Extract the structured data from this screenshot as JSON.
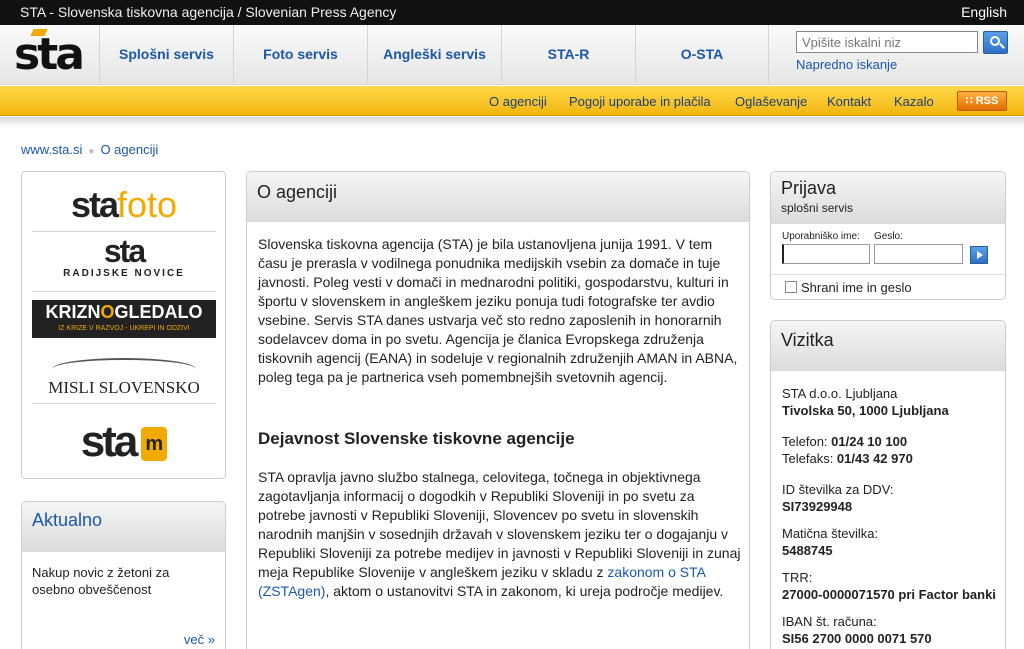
{
  "topbar": {
    "title": "STA - Slovenska tiskovna agencija / Slovenian Press Agency",
    "language": "English"
  },
  "logo": {
    "text": "sta"
  },
  "nav": [
    {
      "label": "Splošni servis"
    },
    {
      "label": "Foto servis"
    },
    {
      "label": "Angleški servis"
    },
    {
      "label": "STA-R"
    },
    {
      "label": "O-STA"
    }
  ],
  "search": {
    "placeholder": "Vpišite iskalni niz",
    "advanced": "Napredno iskanje"
  },
  "subnav": [
    {
      "label": "O agenciji"
    },
    {
      "label": "Pogoji uporabe in plačila"
    },
    {
      "label": "Oglaševanje"
    },
    {
      "label": "Kontakt"
    },
    {
      "label": "Kazalo"
    }
  ],
  "rss": "RSS",
  "breadcrumb": {
    "home": "www.sta.si",
    "current": "O agenciji"
  },
  "brand_logos": {
    "stafoto_a": "sta",
    "stafoto_b": "foto",
    "radijske_a": "sta",
    "radijske_b": "RADIJSKE NOVICE",
    "krizno_a": "KRIZN",
    "krizno_o": "O",
    "krizno_b": "GLEDALO",
    "krizno_sub": "IZ KRIZE V RAZVOJ - UKREPI IN ODZIVI",
    "misli": "MISLI SLOVENSKO",
    "stam_a": "sta",
    "stam_b": "m"
  },
  "aktualno": {
    "title": "Aktualno",
    "text": "Nakup novic z žetoni za osebno obveščenost",
    "more": "več »"
  },
  "main": {
    "title": "O agenciji",
    "p1": "Slovenska tiskovna agencija (STA) je bila ustanovljena junija 1991. V tem času je prerasla v vodilnega ponudnika medijskih vsebin za domače in tuje javnosti. Poleg vesti v domači in mednarodni politiki, gospodarstvu, kulturi in športu v slovenskem in angleškem jeziku ponuja tudi fotografske ter avdio vsebine. Servis STA danes ustvarja več sto redno zaposlenih in honorarnih sodelavcev doma in po svetu. Agencija je članica Evropskega združenja tiskovnih agencij (EANA) in sodeluje v regionalnih združenjih AMAN in ABNA, poleg tega pa je partnerica vseh pomembnejših svetovnih agencij.",
    "h2": "Dejavnost Slovenske tiskovne agencije",
    "p2_a": "STA opravlja javno službo stalnega, celovitega, točnega in objektivnega zagotavljanja informacij o dogodkih v Republiki Sloveniji in po svetu za potrebe javnosti v Republiki Sloveniji, Slovencev po svetu in slovenskih narodnih manjšin v sosednjih državah v slovenskem jeziku ter o dogajanju v Republiki Sloveniji za potrebe medijev in javnosti v Republiki Sloveniji in zunaj meja Republike Slovenije v angleškem jeziku v skladu z ",
    "p2_link": "zakonom o STA (ZSTAgen)",
    "p2_b": ", aktom o ustanovitvi STA in zakonom, ki ureja področje medijev."
  },
  "login": {
    "title": "Prijava",
    "subtitle": "splošni servis",
    "user_label": "Uporabniško ime:",
    "pass_label": "Geslo:",
    "remember": "Shrani ime in geslo"
  },
  "vizitka": {
    "title": "Vizitka",
    "company": "STA d.o.o. Ljubljana",
    "address": "Tivolska 50, 1000 Ljubljana",
    "phone_label": "Telefon: ",
    "phone": "01/24 10 100",
    "fax_label": "Telefaks: ",
    "fax": "01/43 42 970",
    "vat_label": "ID številka za DDV:",
    "vat": "SI73929948",
    "reg_label": "Matična številka:",
    "reg": "5488745",
    "trr_label": "TRR:",
    "trr": "27000-0000071570 pri Factor banki",
    "iban_label": "IBAN št. računa:",
    "iban": "SI56 2700 0000 0071 570"
  }
}
